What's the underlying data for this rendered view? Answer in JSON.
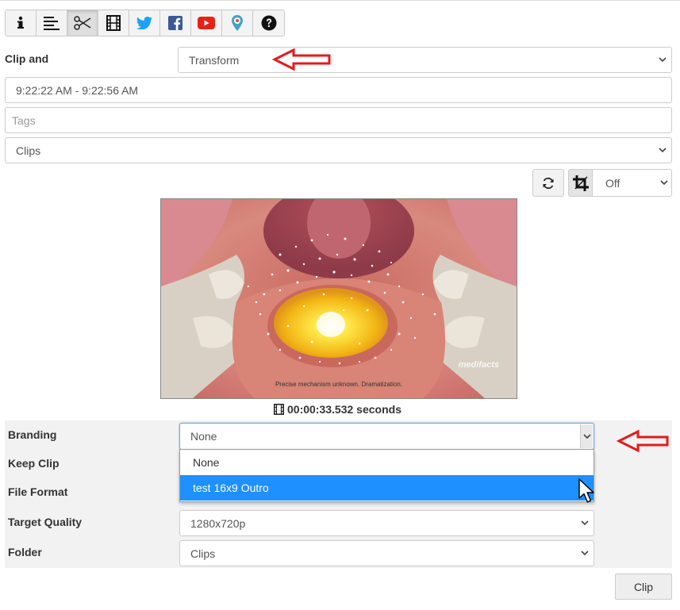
{
  "toolbar": {
    "buttons": [
      {
        "icon": "info-icon"
      },
      {
        "icon": "text-align-icon"
      },
      {
        "icon": "scissors-icon",
        "active": true
      },
      {
        "icon": "film-icon"
      },
      {
        "icon": "twitter-icon"
      },
      {
        "icon": "facebook-icon"
      },
      {
        "icon": "youtube-icon"
      },
      {
        "icon": "periscope-icon"
      },
      {
        "icon": "help-icon"
      }
    ]
  },
  "clip_and": {
    "label": "Clip and",
    "value": "Transform"
  },
  "time_range": {
    "value": "9:22:22 AM - 9:22:56 AM"
  },
  "tags": {
    "placeholder": "Tags"
  },
  "destination": {
    "value": "Clips"
  },
  "crop": {
    "value": "Off"
  },
  "video": {
    "watermark": "medifacts",
    "caption": "Precise mechanism unknown. Dramatization."
  },
  "duration": {
    "text": "00:00:33.532 seconds"
  },
  "form": {
    "branding": {
      "label": "Branding",
      "value": "None"
    },
    "keep_clip": {
      "label": "Keep Clip"
    },
    "file_format": {
      "label": "File Format"
    },
    "target_quality": {
      "label": "Target Quality",
      "value": "1280x720p"
    },
    "folder": {
      "label": "Folder",
      "value": "Clips"
    }
  },
  "branding_dropdown": {
    "options": [
      "None",
      "test 16x9 Outro"
    ],
    "highlighted_index": 1
  },
  "clip_button": {
    "label": "Clip"
  },
  "colors": {
    "annotation_arrow": "#e31b1b",
    "highlight": "#1e90ff",
    "twitter": "#1da1f2",
    "facebook": "#3b5998",
    "youtube": "#e62117",
    "periscope": "#40a4c4"
  }
}
